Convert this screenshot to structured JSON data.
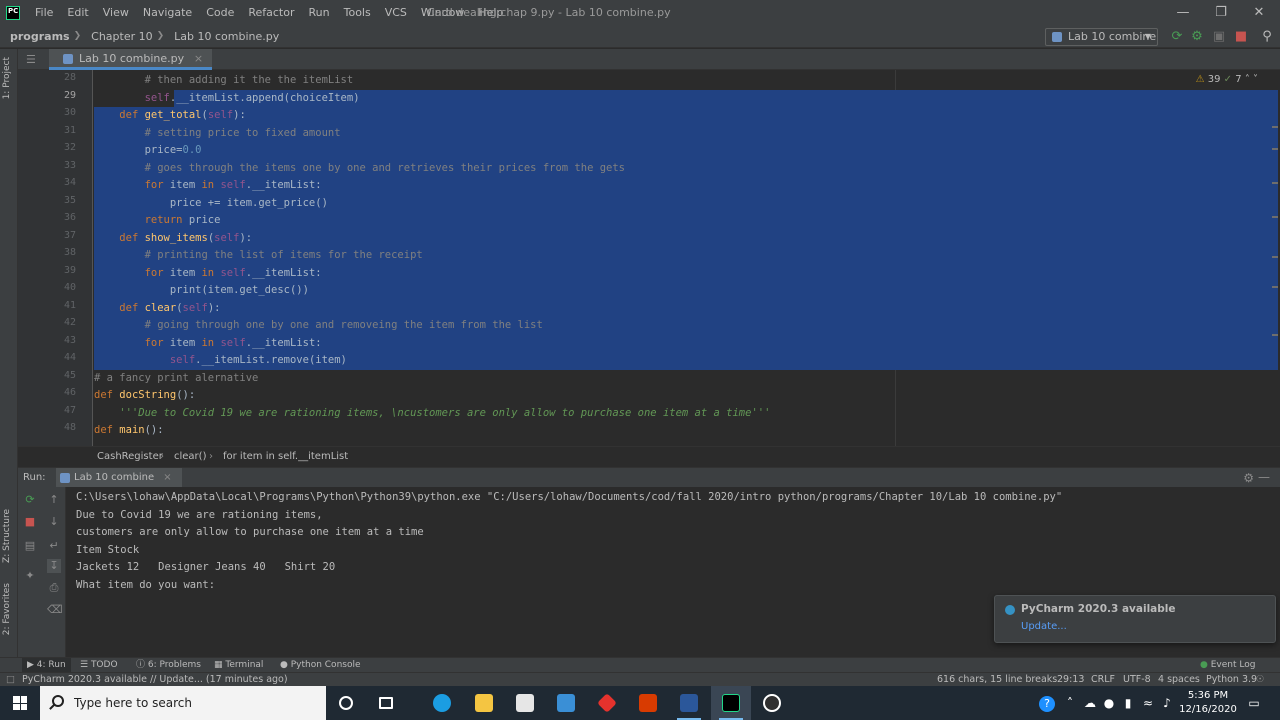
{
  "menubar": {
    "items": [
      "File",
      "Edit",
      "View",
      "Navigate",
      "Code",
      "Refactor",
      "Run",
      "Tools",
      "VCS",
      "Window",
      "Help"
    ],
    "window_title": "Card dealing chap 9.py - Lab 10 combine.py"
  },
  "navbar": {
    "crumbs": [
      "programs",
      "Chapter 10",
      "Lab 10 combine.py"
    ],
    "run_config": "Lab 10 combine"
  },
  "left_strip": {
    "project_tab": "1: Project",
    "structure_tab": "Z: Structure",
    "favorites_tab": "2: Favorites"
  },
  "editor": {
    "tab_label": "Lab 10 combine.py",
    "inspections": {
      "warnings": "39",
      "ok": "7"
    },
    "lines": [
      {
        "n": "28",
        "text": "        # then adding it the the itemList"
      },
      {
        "n": "29",
        "text": "        self.__itemList.append(choiceItem)"
      },
      {
        "n": "30",
        "text": "    def get_total(self):"
      },
      {
        "n": "31",
        "text": "        # setting price to fixed amount"
      },
      {
        "n": "32",
        "text": "        price=0.0"
      },
      {
        "n": "33",
        "text": "        # goes through the items one by one and retrieves their prices from the gets"
      },
      {
        "n": "34",
        "text": "        for item in self.__itemList:"
      },
      {
        "n": "35",
        "text": "            price += item.get_price()"
      },
      {
        "n": "36",
        "text": "        return price"
      },
      {
        "n": "37",
        "text": "    def show_items(self):"
      },
      {
        "n": "38",
        "text": "        # printing the list of items for the receipt"
      },
      {
        "n": "39",
        "text": "        for item in self.__itemList:"
      },
      {
        "n": "40",
        "text": "            print(item.get_desc())"
      },
      {
        "n": "41",
        "text": "    def clear(self):"
      },
      {
        "n": "42",
        "text": "        # going through one by one and removeing the item from the list"
      },
      {
        "n": "43",
        "text": "        for item in self.__itemList:"
      },
      {
        "n": "44",
        "text": "            self.__itemList.remove(item)"
      },
      {
        "n": "45",
        "text": "# a fancy print alernative"
      },
      {
        "n": "46",
        "text": "def docString():"
      },
      {
        "n": "47",
        "text": "    '''Due to Covid 19 we are rationing items, \\ncustomers are only allow to purchase one item at a time'''"
      },
      {
        "n": "48",
        "text": "def main():"
      }
    ]
  },
  "breadcrumbs": [
    "CashRegister",
    "clear()",
    "for item in self.__itemList"
  ],
  "run_panel": {
    "label": "Run:",
    "tab": "Lab 10 combine",
    "console": [
      "C:\\Users\\lohaw\\AppData\\Local\\Programs\\Python\\Python39\\python.exe \"C:/Users/lohaw/Documents/cod/fall 2020/intro python/programs/Chapter 10/Lab 10 combine.py\"",
      "Due to Covid 19 we are rationing items,",
      "customers are only allow to purchase one item at a time",
      "Item Stock",
      "Jackets 12   Designer Jeans 40   Shirt 20",
      "What item do you want:"
    ]
  },
  "notification": {
    "title": "PyCharm 2020.3 available",
    "link": "Update..."
  },
  "tool_windows": {
    "run": "4: Run",
    "todo": "TODO",
    "problems": "6: Problems",
    "terminal": "Terminal",
    "python_console": "Python Console",
    "event_log": "Event Log"
  },
  "statusbar": {
    "message": "PyCharm 2020.3 available // Update... (17 minutes ago)",
    "chars": "616 chars, 15 line breaks",
    "position": "29:13",
    "line_sep": "CRLF",
    "encoding": "UTF-8",
    "indent": "4 spaces",
    "interpreter": "Python 3.9"
  },
  "taskbar": {
    "search_placeholder": "Type here to search",
    "time": "5:36 PM",
    "date": "12/16/2020"
  },
  "colors": {
    "selection": "#214283",
    "accent": "#4a88c7",
    "link": "#589df6"
  }
}
